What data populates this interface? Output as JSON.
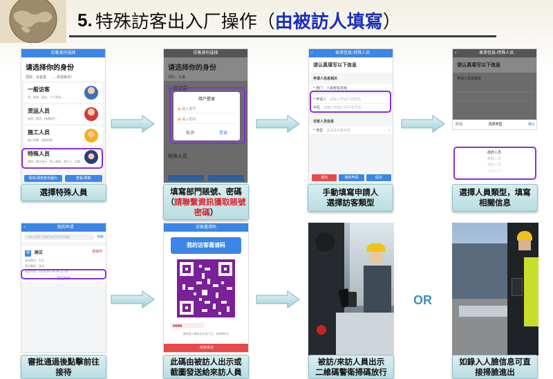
{
  "title": {
    "number": "5.",
    "main": "特殊訪客出入厂操作",
    "paren_open": "（",
    "highlight": "由被訪人填寫",
    "paren_close": "）"
  },
  "screen1": {
    "header": "访客身份选择",
    "heading": "请选择你的身份",
    "greeting": "您好，云善善　　，欢迎来访!",
    "items": [
      {
        "name": "一般访客",
        "desc": "如：参观、面试、个人拜访..."
      },
      {
        "name": "货运人员",
        "desc": "送货、提货、快递配件..."
      },
      {
        "name": "施工人员",
        "desc": "施工承建、维修保养..."
      },
      {
        "name": "特殊人员",
        "desc": "政府、审计会计、参入调研、政工人、出差..."
      }
    ],
    "btn_left": "保存/调用身份图片",
    "btn_right": "查看/录取"
  },
  "screen2": {
    "header": "访客身份选择",
    "heading": "请选择你的身份",
    "greeting": "您好，云善",
    "dialog_title": "用户登录",
    "field_user": "输入账号",
    "field_pass": "输入密码",
    "cancel": "取消",
    "login": "登录",
    "item_general": "一般访客",
    "item_special": "特殊人员"
  },
  "screen3": {
    "header": "表单信息-特殊人员",
    "heading": "请认真填写以下信息",
    "section_applicant": "申请人信息相关",
    "dept_label": "* 部门",
    "dept_value": "人資部信息组",
    "applicant_label": "* 申请人",
    "applicant_ph": "请输入申请人的姓名",
    "phone_label": "手机",
    "phone_ph": "请输入申请人的手机号码",
    "section_visitor": "访客人员信息",
    "type_label": "* 类型",
    "type_ph": "请选择访客类型",
    "btn_back": "退出",
    "btn_mine": "我的申请",
    "btn_submit": "提交"
  },
  "screen4": {
    "header": "表单信息-特殊人员",
    "heading": "请认真填写以下信息",
    "section": "申请人信息相关",
    "cancel": "取消",
    "picker_title": "选择类型",
    "confirm": "确认",
    "options": [
      "政府人员",
      "审核人员",
      "调研人员",
      "外来人员"
    ]
  },
  "screen5": {
    "header": "我的申请",
    "search_ph": "输入访客人员姓名或手机号码搜索",
    "search_btn": "搜索",
    "badge": "特",
    "visitor": "测试",
    "status": "未操作",
    "row1": "来访单位：123",
    "row2": "拜访事由：测试",
    "row3": "来访时间：2020-04-08 09:11:00",
    "action": "前往操作"
  },
  "screen6": {
    "header": "访客邀请码",
    "banner": "我的访客邀请码",
    "note": "请将此二维码出示给门卫，有效期1天",
    "footer_btn": "结束来访"
  },
  "captions": {
    "c1": "選擇特殊人員",
    "c2_line1": "填寫部門賬號、密碼",
    "c2_red": "請聯繫資訊獲取賬號密碼",
    "c2_paren_open": "（",
    "c2_paren_close": "）",
    "c3_line1": "手動填寫申請人",
    "c3_line2": "選擇訪客類型",
    "c4_line1": "選擇人員類型，填寫",
    "c4_line2": "相關信息",
    "c5_line1": "審批通過後點擊前往",
    "c5_line2": "接待",
    "c6_line1": "此碼由被訪人出示或",
    "c6_line2": "截圖發送給來訪人員",
    "c7_line1": "被訪/來訪人員出示",
    "c7_line2": "二維碼警衛掃碼放行",
    "c8_line1": "如錄入人臉信息可直",
    "c8_line2": "接掃臉進出"
  },
  "or_label": "OR",
  "colors": {
    "accent": "#3b86e6",
    "highlight": "#8a2be2",
    "red": "#e0202a",
    "title_blue": "#1a2fb8"
  }
}
